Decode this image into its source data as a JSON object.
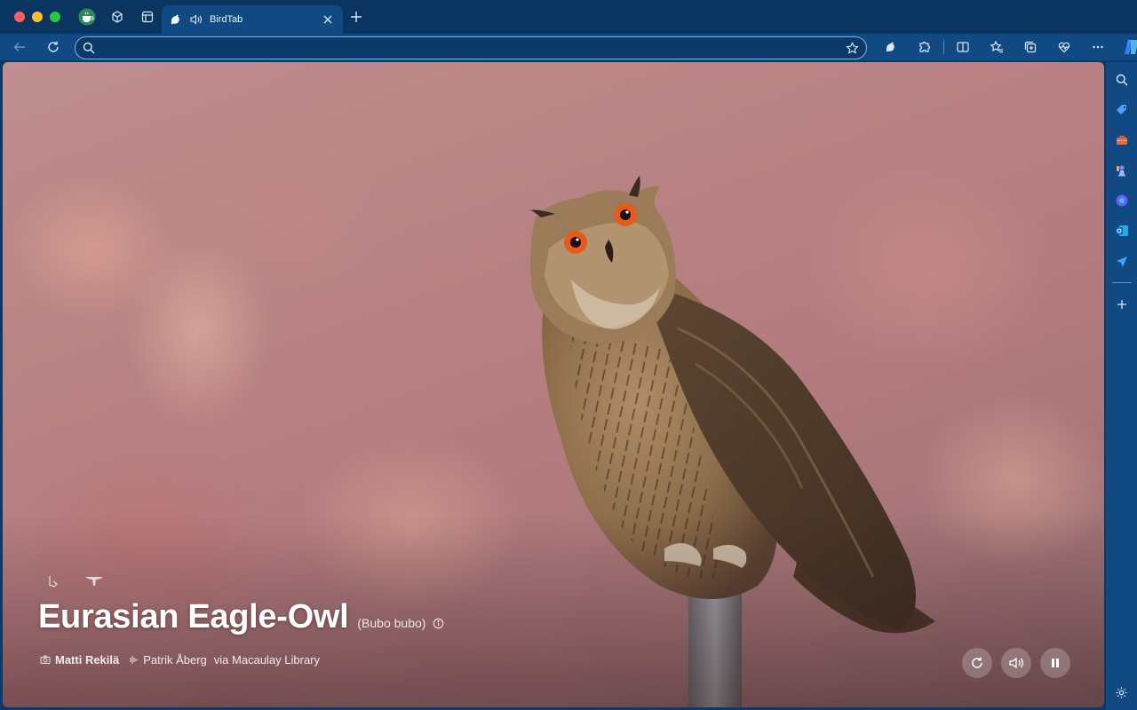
{
  "browser": {
    "tab": {
      "title": "BirdTab"
    },
    "address_bar": {
      "value": "",
      "placeholder": ""
    }
  },
  "bird": {
    "common_name": "Eurasian Eagle-Owl",
    "scientific_name": "(Bubo bubo)",
    "photographer": "Matti Rekilä",
    "recordist": "Patrik Åberg",
    "source": "via Macaulay Library"
  },
  "colors": {
    "tab_bar": "#0a3560",
    "toolbar": "#114a82",
    "accent": "#7fb4e6"
  },
  "icons": {
    "tab_favicon": "bird-icon",
    "sound": "speaker-icon",
    "refresh": "refresh-icon",
    "pause": "pause-icon"
  }
}
